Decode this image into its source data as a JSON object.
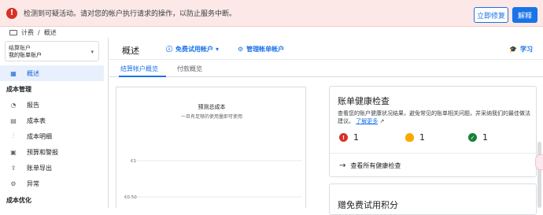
{
  "alert": {
    "message": "检测到可疑活动。请对您的帐户执行请求的操作，以防止服务中断。",
    "fix_label": "立即修复",
    "learn_label": "解释"
  },
  "breadcrumb": {
    "root": "计费",
    "sep": "/",
    "current": "概述"
  },
  "sidebar": {
    "account": {
      "label": "结算账户",
      "name": "我的账单账户"
    },
    "items": [
      {
        "label": "概述",
        "icon": "dashboard-icon",
        "active": true
      }
    ],
    "section_cost_mgmt": "成本管理",
    "cost_items": [
      {
        "label": "报告",
        "icon": "report-icon"
      },
      {
        "label": "成本表",
        "icon": "table-icon"
      },
      {
        "label": "成本明细",
        "icon": "breakdown-icon"
      },
      {
        "label": "预算和警报",
        "icon": "budget-icon"
      },
      {
        "label": "账单导出",
        "icon": "export-icon"
      },
      {
        "label": "异常",
        "icon": "anomaly-icon"
      }
    ],
    "section_cost_opt": "成本优化"
  },
  "header": {
    "title": "概述",
    "free_trial": "免费试用帐户",
    "manage_accounts": "管理帐单帐户",
    "learn": "学习"
  },
  "tabs": [
    "结算帐户概览",
    "付款概览"
  ],
  "chart": {
    "title": "预测总成本",
    "subtitle": "一旦有足够的使用量即可使用",
    "ticks": [
      "€1",
      "€0.50"
    ]
  },
  "health": {
    "title": "账单健康检查",
    "desc": "查看您的账户健康状况结果，避免常见的账单相关问题，并采纳我们的最佳做法建议。",
    "learn_more": "了解更多",
    "stats": [
      {
        "value": "1",
        "icon": "error-icon",
        "color": "#d93025"
      },
      {
        "value": "1",
        "icon": "lightbulb-icon",
        "color": "#f9ab00"
      },
      {
        "value": "1",
        "icon": "check-icon",
        "color": "#188038"
      }
    ],
    "view_all": "查看所有健康检查"
  },
  "free_card": {
    "title": "赠免费试用积分"
  }
}
